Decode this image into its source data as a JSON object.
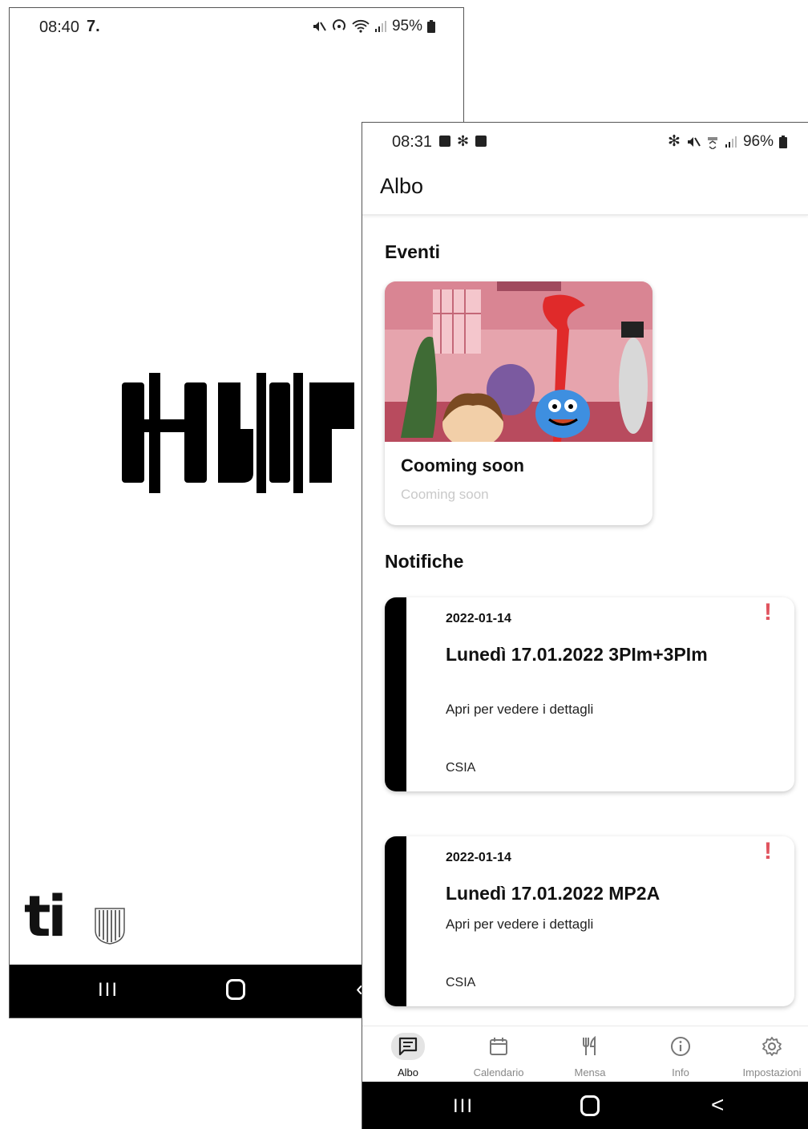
{
  "splash": {
    "status": {
      "time": "08:40",
      "left_icon": "7.",
      "battery": "95%"
    },
    "logo_text": "ti",
    "nav": {
      "recents": "III"
    }
  },
  "albo": {
    "status": {
      "time": "08:31",
      "battery": "96%"
    },
    "appbar_title": "Albo",
    "events_title": "Eventi",
    "event": {
      "title": "Cooming soon",
      "subtitle": "Cooming soon"
    },
    "notifications_title": "Notifiche",
    "notifications": [
      {
        "date": "2022-01-14",
        "title": "Lunedì 17.01.2022 3PIm+3PIm",
        "body": "Apri per vedere i dettagli",
        "author": "CSIA",
        "alert": "!"
      },
      {
        "date": "2022-01-14",
        "title": "Lunedì 17.01.2022 MP2A",
        "body": "Apri per vedere i dettagli",
        "author": "CSIA",
        "alert": "!"
      }
    ],
    "bottom_nav": [
      {
        "label": "Albo",
        "icon": "message-square-icon",
        "active": true
      },
      {
        "label": "Calendario",
        "icon": "calendar-icon",
        "active": false
      },
      {
        "label": "Mensa",
        "icon": "utensils-icon",
        "active": false
      },
      {
        "label": "Info",
        "icon": "info-icon",
        "active": false
      },
      {
        "label": "Impostazioni",
        "icon": "gear-icon",
        "active": false
      }
    ],
    "sysnav": {
      "recents": "III",
      "back": "<"
    }
  },
  "colors": {
    "alert": "#e0535e",
    "stripe": "#000000",
    "muted_text": "#c9c9c9",
    "active_nav_bg": "#e4e4e4"
  }
}
